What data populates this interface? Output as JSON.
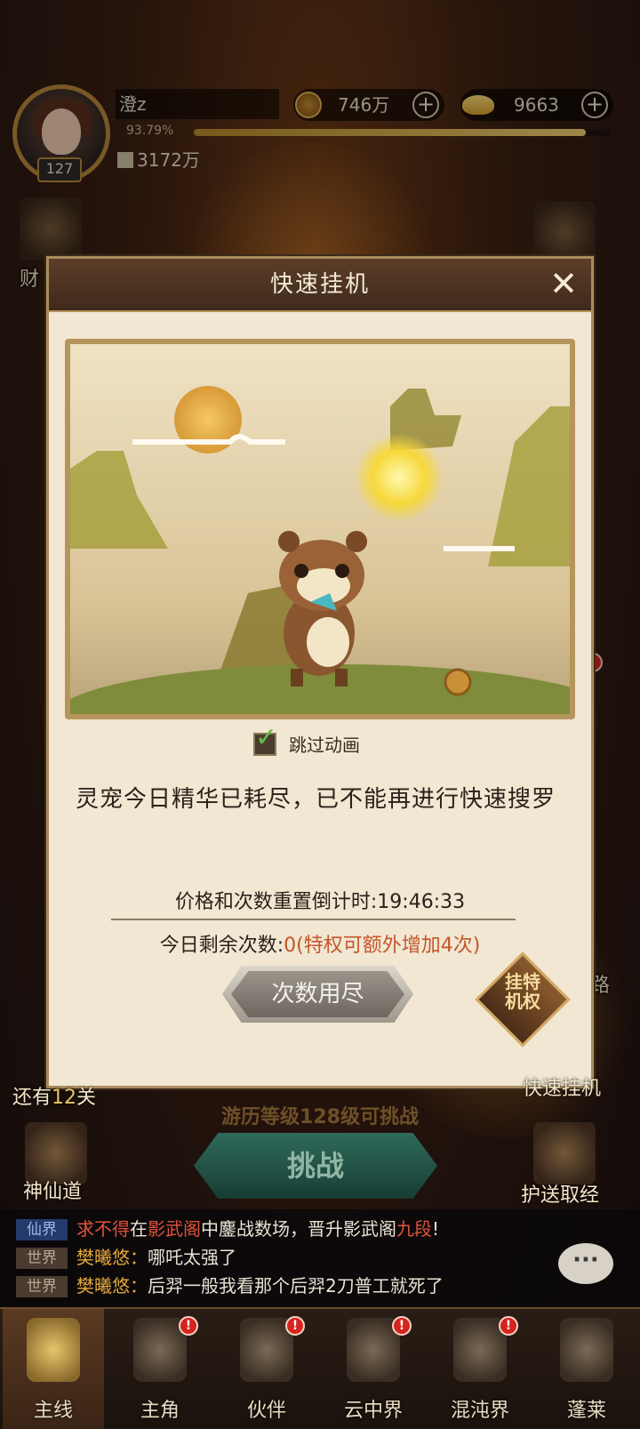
{
  "player": {
    "name": "澄z",
    "level": "127",
    "exp_percent": "93.79%",
    "exp_fraction": 0.9379,
    "power": "3172万"
  },
  "resources": {
    "copper": "746万",
    "gold": "9663"
  },
  "side_labels": {
    "left_top": "财",
    "right_stage": "还有",
    "stage_count": "12",
    "stage_suffix": "关",
    "quick_idle": "快速挂机",
    "road": "路",
    "immortal_path": "神仙道",
    "escort": "护送取经"
  },
  "dialog": {
    "title": "快速挂机",
    "close_label": "✕",
    "skip_animation_label": "跳过动画",
    "skip_animation_checked": true,
    "message": "灵宠今日精华已耗尽，已不能再进行快速搜罗",
    "timer_label": "价格和次数重置倒计时:",
    "timer_value": "19:46:33",
    "remaining_label": "今日剩余次数:",
    "remaining_value": "0",
    "remaining_extra": "(特权可额外增加4次)",
    "button_label": "次数用尽",
    "privilege_label_1": "挂",
    "privilege_label_2": "特",
    "privilege_label_3": "机",
    "privilege_label_4": "权"
  },
  "challenge": {
    "hint": "游历等级128级可挑战",
    "button_label": "挑战"
  },
  "chat": {
    "lines": [
      {
        "channel": "仙界",
        "speaker": "求不得",
        "text_1": "在",
        "place": "影武阁",
        "text_2": "中鏖战数场，晋升影武阁",
        "rank": "九段",
        "text_3": "!"
      },
      {
        "channel": "世界",
        "speaker": "樊曦悠",
        "text": "哪吒太强了"
      },
      {
        "channel": "世界",
        "speaker": "樊曦悠",
        "text": "后羿一般我看那个后羿2刀普工就死了"
      }
    ],
    "button_label": "···"
  },
  "nav": {
    "items": [
      {
        "label": "主线",
        "badge": false
      },
      {
        "label": "主角",
        "badge": true
      },
      {
        "label": "伙伴",
        "badge": true
      },
      {
        "label": "云中界",
        "badge": true
      },
      {
        "label": "混沌界",
        "badge": true
      },
      {
        "label": "蓬莱",
        "badge": false
      }
    ]
  },
  "colors": {
    "accent_gold": "#b8893a",
    "dialog_bg": "#f1e7d3",
    "highlight_red": "#c5562a",
    "challenge_teal": "#2f6a5a"
  }
}
